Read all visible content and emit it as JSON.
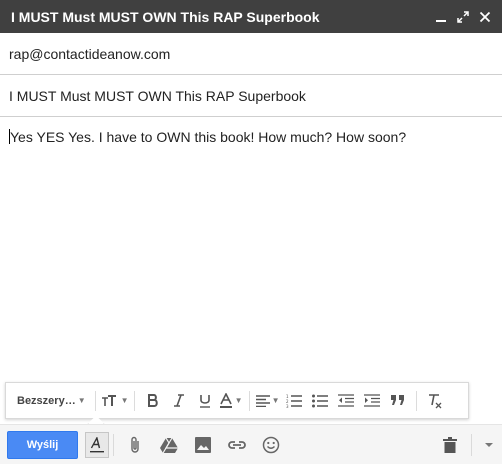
{
  "window": {
    "title": "I MUST Must MUST OWN This RAP Superbook",
    "controls": [
      "minimize-icon",
      "expand-icon",
      "close-icon"
    ]
  },
  "compose": {
    "to": "rap@contactideanow.com",
    "subject": "I MUST Must MUST OWN This RAP Superbook",
    "body": "Yes YES Yes. I have to OWN this book! How much? How soon?"
  },
  "format_toolbar": {
    "font_label": "Bezszery…",
    "buttons": [
      "text-size-icon",
      "bold-icon",
      "italic-icon",
      "underline-icon",
      "text-color-icon",
      "align-icon",
      "numbered-list-icon",
      "bulleted-list-icon",
      "indent-less-icon",
      "indent-more-icon",
      "quote-icon",
      "remove-formatting-icon"
    ]
  },
  "bottom_bar": {
    "send_label": "Wyślij",
    "icons": [
      "formatting-toggle-icon",
      "attach-icon",
      "drive-icon",
      "photo-icon",
      "link-icon",
      "emoji-icon",
      "trash-icon",
      "more-options-icon"
    ]
  },
  "colors": {
    "titlebar": "#404040",
    "send_button": "#4a8af4",
    "bottom_bar": "#f5f5f5"
  }
}
